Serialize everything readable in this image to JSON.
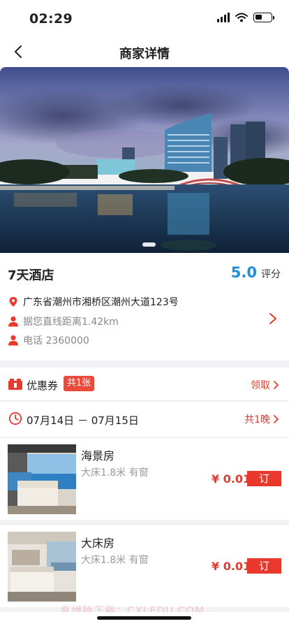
{
  "status_bar": {
    "time": "02:29",
    "battery_level": 0.45
  },
  "nav": {
    "title": "商家详情",
    "back_icon": "chevron-left-icon"
  },
  "hero": {
    "carousel_current": 1,
    "carousel_total": 1
  },
  "hotel": {
    "name": "7天酒店",
    "rating_score": "5.0",
    "rating_label": "评分",
    "address": "广东省潮州市湘桥区潮州大道123号",
    "distance": "据您直线距离1.42km",
    "phone": "电话 2360000"
  },
  "coupon": {
    "label": "优惠券",
    "badge": "共1张",
    "action": "领取"
  },
  "stay": {
    "dates": "07月14日 － 07月15日",
    "nights": "共1晚"
  },
  "rooms": [
    {
      "name": "海景房",
      "desc": "大床1.8米 有窗",
      "price": "¥ 0.01",
      "button": "订"
    },
    {
      "name": "大床房",
      "desc": "大床1.8米 有窗",
      "price": "¥ 0.01",
      "button": "订"
    }
  ],
  "watermark": "真博猿下载：CXLEDU.COM",
  "colors": {
    "accent_red": "#e8392c",
    "rating_blue": "#1e8ed8"
  }
}
